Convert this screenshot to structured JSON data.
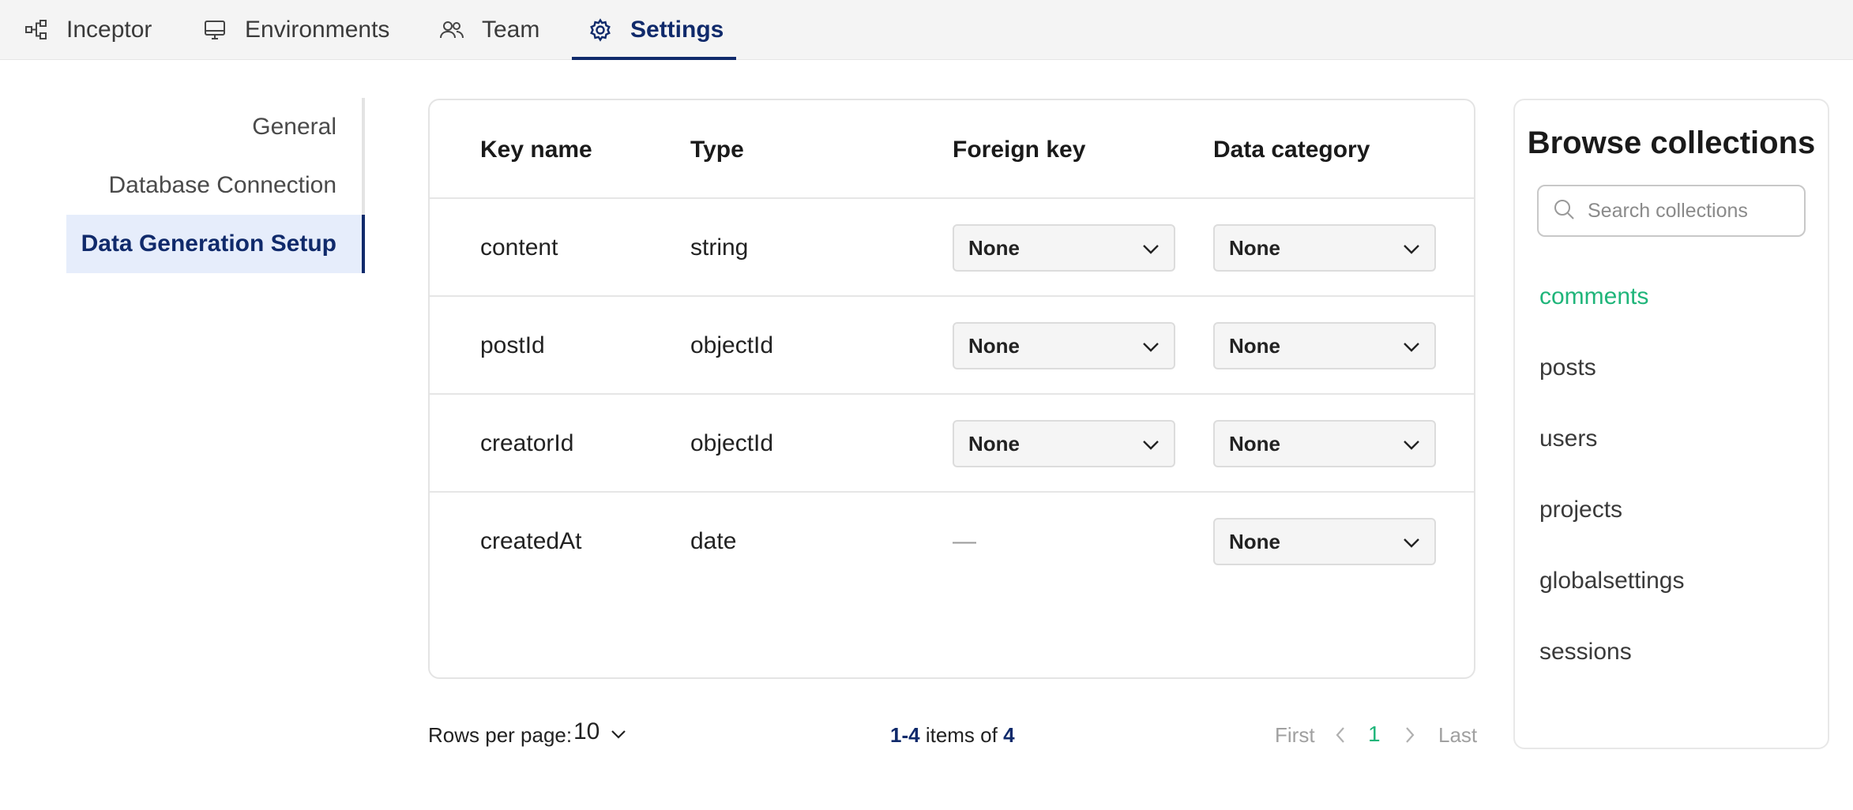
{
  "nav": {
    "tabs": [
      {
        "label": "Inceptor",
        "icon": "flow-icon"
      },
      {
        "label": "Environments",
        "icon": "monitor-icon"
      },
      {
        "label": "Team",
        "icon": "users-icon"
      },
      {
        "label": "Settings",
        "icon": "gear-icon",
        "active": true
      }
    ]
  },
  "settings_menu": {
    "items": [
      {
        "label": "General"
      },
      {
        "label": "Database Connection"
      },
      {
        "label": "Data Generation Setup",
        "active": true
      }
    ]
  },
  "table": {
    "headers": {
      "key_name": "Key name",
      "type": "Type",
      "foreign_key": "Foreign key",
      "data_category": "Data category"
    },
    "rows": [
      {
        "key": "content",
        "type": "string",
        "foreign_key": "None",
        "data_category": "None"
      },
      {
        "key": "postId",
        "type": "objectId",
        "foreign_key": "None",
        "data_category": "None"
      },
      {
        "key": "creatorId",
        "type": "objectId",
        "foreign_key": "None",
        "data_category": "None"
      },
      {
        "key": "createdAt",
        "type": "date",
        "foreign_key": "—",
        "data_category": "None"
      }
    ]
  },
  "pagination": {
    "rows_per_page_label": "Rows per page:",
    "rows_per_page_value": "10",
    "range": "1-4",
    "items_of_label": "items of",
    "total": "4",
    "first_label": "First",
    "current_page": "1",
    "last_label": "Last"
  },
  "browse": {
    "title": "Browse collections",
    "search_placeholder": "Search collections",
    "collections": [
      "comments",
      "posts",
      "users",
      "projects",
      "globalsettings",
      "sessions"
    ],
    "active_collection": "comments"
  },
  "colors": {
    "accent_navy": "#102a6b",
    "accent_green": "#1fb57a"
  }
}
